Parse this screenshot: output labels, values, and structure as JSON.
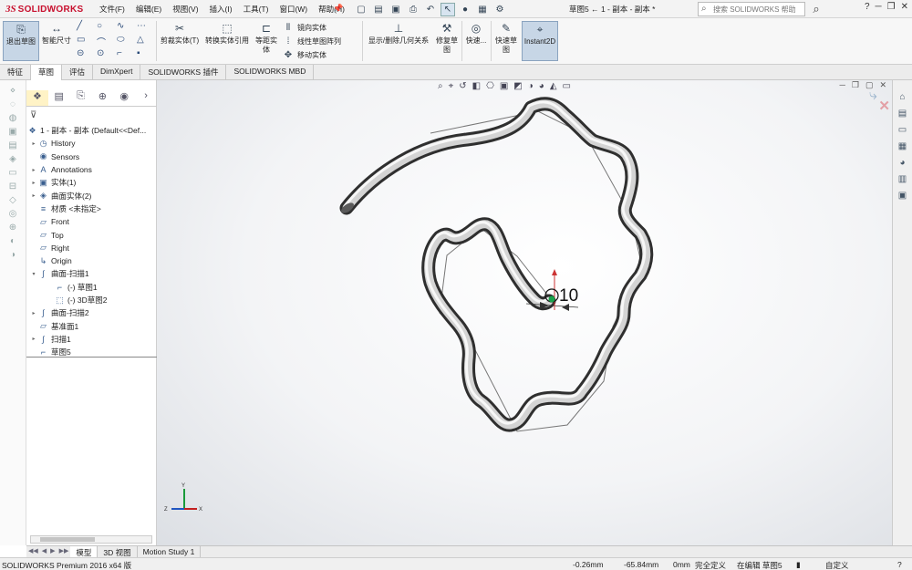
{
  "app": {
    "logo_ds": "3S",
    "logo_name": "SOLIDWORKS"
  },
  "menu": [
    "文件(F)",
    "编辑(E)",
    "视图(V)",
    "插入(I)",
    "工具(T)",
    "窗口(W)",
    "帮助(H)"
  ],
  "document_title": "草图5 ← 1 - 副本 - 副本 *",
  "help_search": {
    "placeholder": "搜索 SOLIDWORKS 帮助"
  },
  "ribbon": {
    "exit_sketch": "退出草图",
    "smart_dim": "智能尺寸",
    "trim": "剪裁实体(T)",
    "convert": "转换实体引用",
    "offset": "等距实体",
    "mirror": "镜向实体",
    "linear_pattern": "线性草图阵列",
    "move": "移动实体",
    "relations": "显示/删除几何关系",
    "repair": "修复草图",
    "quick_snaps": "快速...",
    "rapid_sketch": "快速草图",
    "instant2d": "Instant2D"
  },
  "tabs": [
    "特征",
    "草图",
    "评估",
    "DimXpert",
    "SOLIDWORKS 插件",
    "SOLIDWORKS MBD"
  ],
  "active_tab": "草图",
  "tree": {
    "root": "1 - 副本 - 副本  (Default<<Def...",
    "items": [
      {
        "label": "History",
        "expand": "▸",
        "icon": "history-icon",
        "indent": 1
      },
      {
        "label": "Sensors",
        "expand": "",
        "icon": "sensor-icon",
        "indent": 1
      },
      {
        "label": "Annotations",
        "expand": "▸",
        "icon": "annotations-icon",
        "indent": 1
      },
      {
        "label": "实体(1)",
        "expand": "▸",
        "icon": "solid-bodies-icon",
        "indent": 1
      },
      {
        "label": "曲面实体(2)",
        "expand": "▸",
        "icon": "surface-bodies-icon",
        "indent": 1
      },
      {
        "label": "材质 <未指定>",
        "expand": "",
        "icon": "material-icon",
        "indent": 1
      },
      {
        "label": "Front",
        "expand": "",
        "icon": "plane-icon",
        "indent": 1
      },
      {
        "label": "Top",
        "expand": "",
        "icon": "plane-icon",
        "indent": 1
      },
      {
        "label": "Right",
        "expand": "",
        "icon": "plane-icon",
        "indent": 1
      },
      {
        "label": "Origin",
        "expand": "",
        "icon": "origin-icon",
        "indent": 1
      },
      {
        "label": "曲面-扫描1",
        "expand": "▾",
        "icon": "sweep-icon",
        "indent": 1
      },
      {
        "label": "(-) 草图1",
        "expand": "",
        "icon": "sketch-icon",
        "indent": 2
      },
      {
        "label": "(-) 3D草图2",
        "expand": "",
        "icon": "3dsketch-icon",
        "indent": 2
      },
      {
        "label": "曲面-扫描2",
        "expand": "▸",
        "icon": "sweep-icon",
        "indent": 1
      },
      {
        "label": "基准面1",
        "expand": "",
        "icon": "plane-icon",
        "indent": 1
      },
      {
        "label": "扫描1",
        "expand": "▸",
        "icon": "sweep-icon",
        "indent": 1
      },
      {
        "label": "草图5",
        "expand": "",
        "icon": "sketch-icon",
        "indent": 1
      }
    ]
  },
  "viewport": {
    "dimension_text": "10"
  },
  "bottom_tabs": [
    "模型",
    "3D 视图",
    "Motion Study 1"
  ],
  "status": {
    "product": "SOLIDWORKS Premium 2016 x64 版",
    "x": "-0.26mm",
    "y": "-65.84mm",
    "z": "0mm",
    "state": "完全定义",
    "editing": "在编辑 草图5",
    "units": "自定义"
  }
}
